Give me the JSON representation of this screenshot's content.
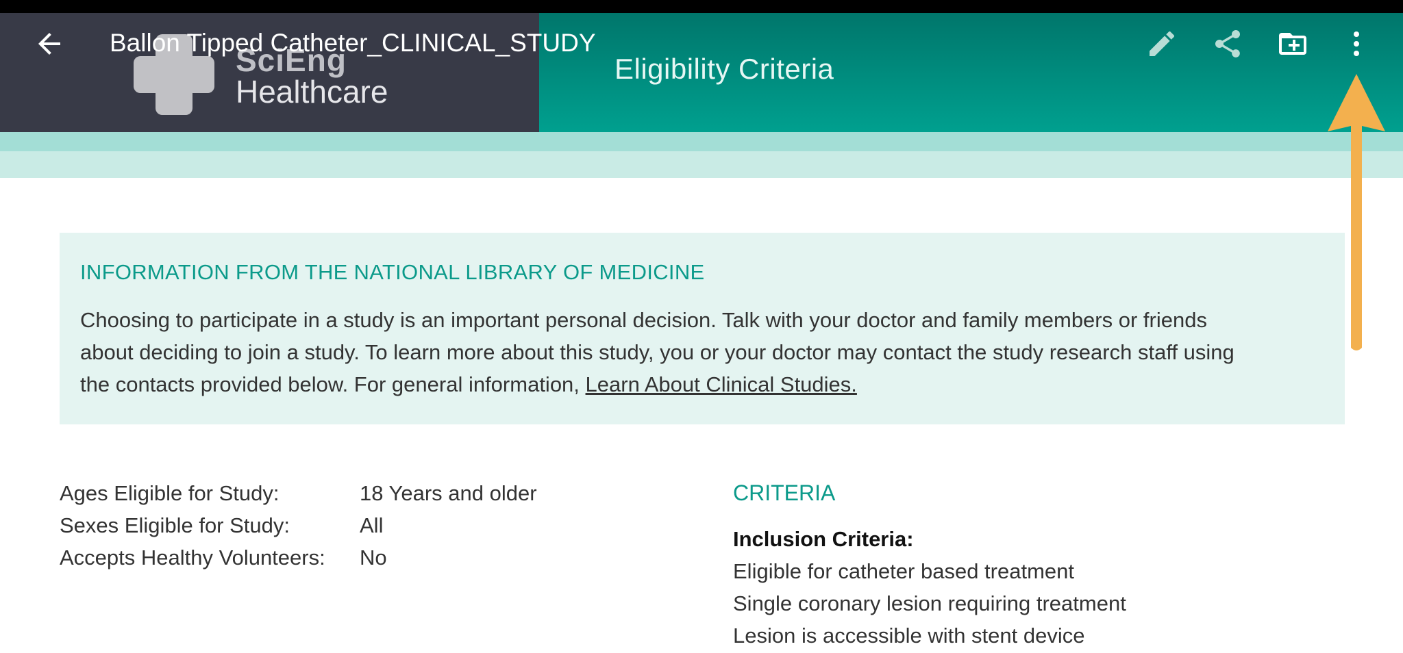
{
  "toolbar": {
    "title": "Ballon Tipped Catheter_CLINICAL_STUDY"
  },
  "banner": {
    "logo_line1": "SciEng",
    "logo_line2": "Healthcare",
    "section_title": "Eligibility Criteria"
  },
  "info": {
    "heading": "INFORMATION FROM THE NATIONAL LIBRARY OF MEDICINE",
    "line1": "Choosing to participate in a study is an important personal decision. Talk with your doctor and family members or friends",
    "line2": "about deciding to join a study. To learn more about this study, you or your doctor may contact the study research staff using",
    "line3": "the contacts provided below. For general information,",
    "link": "Learn About Clinical Studies."
  },
  "eligibility": [
    {
      "label": "Ages Eligible for Study:",
      "value": "18 Years and older"
    },
    {
      "label": "Sexes Eligible for Study:",
      "value": "All"
    },
    {
      "label": "Accepts Healthy Volunteers:",
      "value": "No"
    }
  ],
  "criteria": {
    "heading": "CRITERIA",
    "inclusion_title": "Inclusion Criteria:",
    "items": [
      "Eligible for catheter based treatment",
      "Single coronary lesion requiring treatment",
      "Lesion is accessible with stent device"
    ]
  },
  "icons": {
    "back": "arrow-back-icon",
    "edit": "pencil-icon",
    "share": "share-icon",
    "folder": "folder-add-icon",
    "more": "more-vert-icon"
  },
  "colors": {
    "teal_accent": "#0b9a8a",
    "banner_dark": "#383a47",
    "arrow": "#f3b04e"
  }
}
